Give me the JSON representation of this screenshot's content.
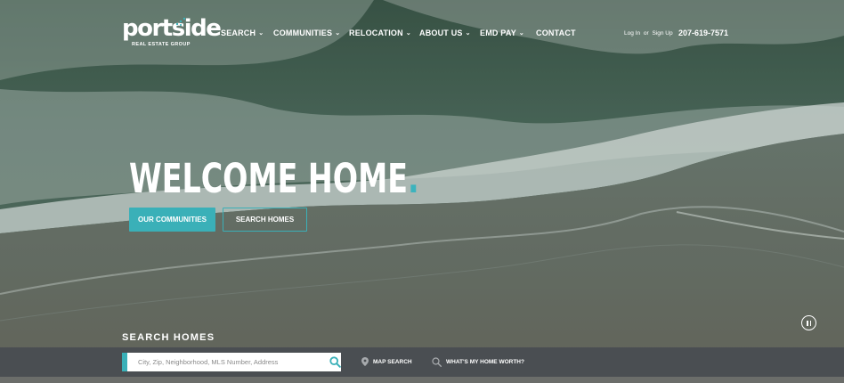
{
  "brand": {
    "logo_word": "portside",
    "logo_sub": "REAL ESTATE GROUP",
    "accent": "#3ab0b8"
  },
  "nav": {
    "items": [
      {
        "label": "SEARCH",
        "has_dropdown": true
      },
      {
        "label": "COMMUNITIES",
        "has_dropdown": true
      },
      {
        "label": "RELOCATION",
        "has_dropdown": true
      },
      {
        "label": "ABOUT US",
        "has_dropdown": true
      },
      {
        "label": "EMD PAY",
        "has_dropdown": true
      },
      {
        "label": "CONTACT",
        "has_dropdown": false
      }
    ],
    "chevron": "⌄"
  },
  "header": {
    "login": "Log In",
    "or": "or",
    "signup": "Sign Up",
    "phone": "207-619-7571"
  },
  "hero": {
    "headline": "WELCOME HOME",
    "headline_dot": ".",
    "primary_button": "OUR COMMUNITIES",
    "secondary_button": "SEARCH HOMES"
  },
  "search": {
    "title": "SEARCH HOMES",
    "placeholder": "City, Zip, Neighborhood, MLS Number, Address",
    "value": "",
    "map_search": "MAP SEARCH",
    "home_worth": "WHAT'S MY HOME WORTH?"
  },
  "icons": {
    "search": "search-icon",
    "map_pin": "map-pin-icon",
    "magnifier": "magnifier-icon",
    "pause": "pause-icon"
  }
}
